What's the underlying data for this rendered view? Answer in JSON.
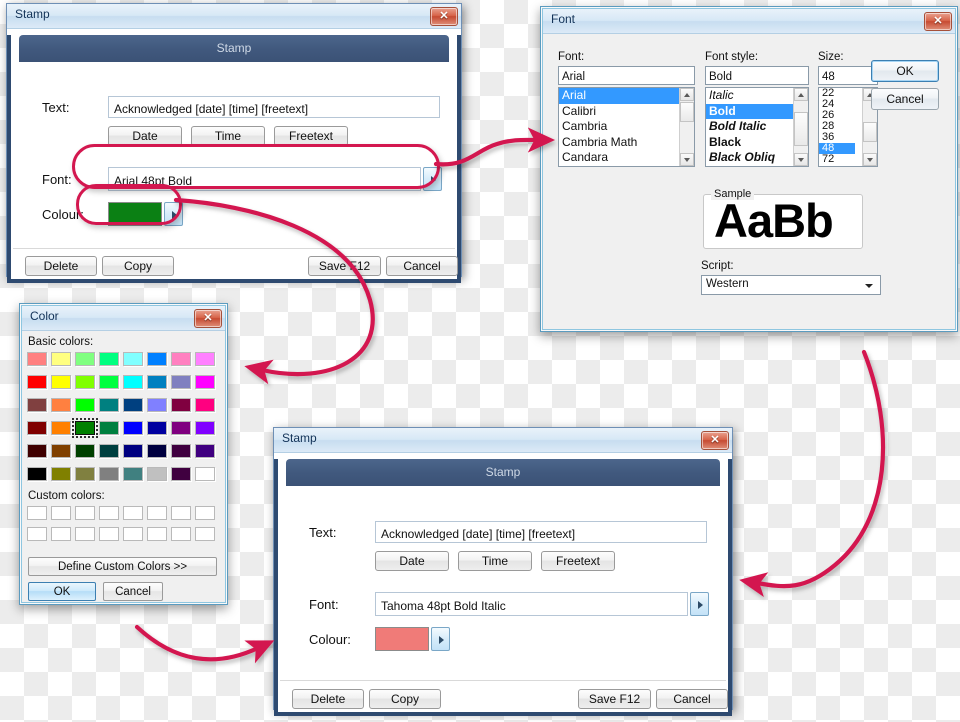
{
  "theme": {
    "accent_annotation": "#d3174f",
    "title_text": "#123257",
    "stamp_header_bg": "#41597e",
    "selection_blue": "#3399ff"
  },
  "stamp_green": {
    "window_title": "Stamp",
    "header": "Stamp",
    "text_label": "Text:",
    "text_value": "Acknowledged [date] [time] [freetext]",
    "token_buttons": [
      "Date",
      "Time",
      "Freetext"
    ],
    "font_label": "Font:",
    "font_value": "Arial 48pt Bold",
    "colour_label": "Colour:",
    "colour_value": "#0b8014",
    "footer_buttons": [
      "Delete",
      "Copy",
      "Save F12",
      "Cancel"
    ],
    "close_icon": "close-icon",
    "dropdown_icon": "triangle-right-icon"
  },
  "stamp_red": {
    "window_title": "Stamp",
    "header": "Stamp",
    "text_label": "Text:",
    "text_value": "Acknowledged [date] [time] [freetext]",
    "token_buttons": [
      "Date",
      "Time",
      "Freetext"
    ],
    "font_label": "Font:",
    "font_value": "Tahoma 48pt Bold Italic",
    "colour_label": "Colour:",
    "colour_value": "#f07b78",
    "footer_buttons": [
      "Delete",
      "Copy",
      "Save F12",
      "Cancel"
    ],
    "close_icon": "close-icon",
    "dropdown_icon": "triangle-right-icon"
  },
  "font_dialog": {
    "window_title": "Font",
    "font_label": "Font:",
    "font_value": "Arial",
    "font_items": [
      "Arial",
      "Calibri",
      "Cambria",
      "Cambria Math",
      "Candara"
    ],
    "font_selected": "Arial",
    "style_label": "Font style:",
    "style_value": "Bold",
    "style_items": [
      "Italic",
      "Bold",
      "Bold Italic",
      "Black",
      "Black Obliq"
    ],
    "style_selected": "Bold",
    "size_label": "Size:",
    "size_value": "48",
    "size_items": [
      "22",
      "24",
      "26",
      "28",
      "36",
      "48",
      "72"
    ],
    "size_selected": "48",
    "sample_caption": "Sample",
    "sample_text": "AaBb",
    "script_label": "Script:",
    "script_value": "Western",
    "ok_label": "OK",
    "cancel_label": "Cancel",
    "close_icon": "close-icon"
  },
  "color_dialog": {
    "window_title": "Color",
    "basic_label": "Basic colors:",
    "custom_label": "Custom colors:",
    "define_label": "Define Custom Colors >>",
    "ok_label": "OK",
    "cancel_label": "Cancel",
    "close_icon": "close-icon",
    "selected_swatch": "#008000",
    "basic_rows": [
      [
        "#ff8080",
        "#ffff80",
        "#80ff80",
        "#00ff80",
        "#80ffff",
        "#0080ff",
        "#ff80c0",
        "#ff80ff"
      ],
      [
        "#ff0000",
        "#ffff00",
        "#80ff00",
        "#00ff40",
        "#00ffff",
        "#0080c0",
        "#8080c0",
        "#ff00ff"
      ],
      [
        "#804040",
        "#ff8040",
        "#00ff00",
        "#008080",
        "#004080",
        "#8080ff",
        "#800040",
        "#ff0080"
      ],
      [
        "#800000",
        "#ff8000",
        "#008000",
        "#008040",
        "#0000ff",
        "#0000a0",
        "#800080",
        "#8000ff"
      ],
      [
        "#400000",
        "#804000",
        "#004000",
        "#004040",
        "#000080",
        "#000040",
        "#400040",
        "#400080"
      ],
      [
        "#000000",
        "#808000",
        "#808040",
        "#808080",
        "#408080",
        "#c0c0c0",
        "#400040",
        "#ffffff"
      ]
    ],
    "custom_rows": 2,
    "custom_cols": 8
  },
  "annotations": {
    "highlight_font_field": "font-field-highlight",
    "highlight_colour_field": "colour-field-highlight",
    "arrow_font_to_fontdialog": "arrow-font-to-font-dialog",
    "arrow_colour_to_colordialog": "arrow-colour-to-color-dialog",
    "arrow_colordialog_to_stamp": "arrow-color-dialog-to-stamp",
    "arrow_fontdialog_to_stamp": "arrow-font-dialog-to-stamp"
  }
}
